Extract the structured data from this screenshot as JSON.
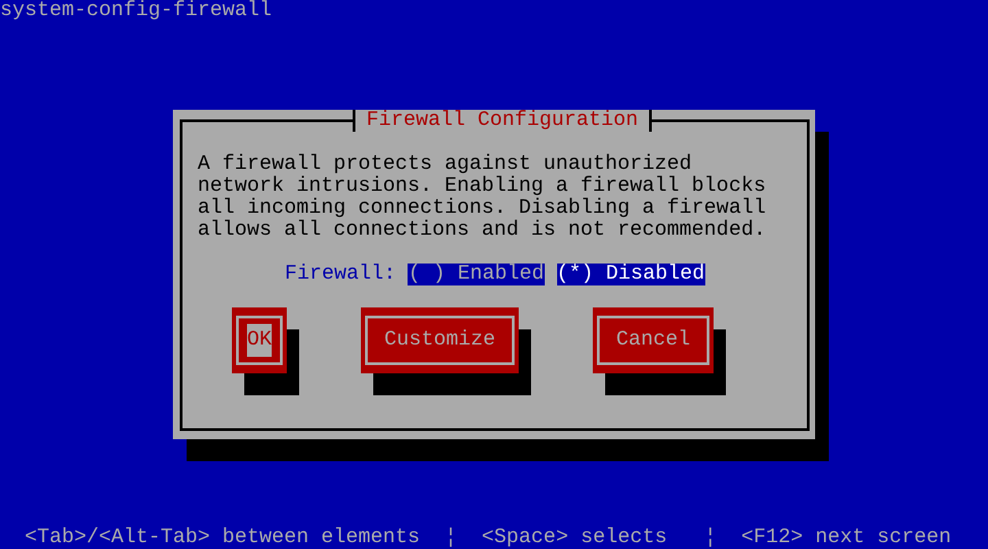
{
  "window": {
    "title": "system-config-firewall"
  },
  "dialog": {
    "title": "Firewall Configuration",
    "message": "A firewall protects against unauthorized\nnetwork intrusions. Enabling a firewall blocks\nall incoming connections. Disabling a firewall\nallows all connections and is not recommended.",
    "firewall_label": "Firewall:",
    "options": [
      {
        "marker": "( )",
        "label": "Enabled",
        "selected": false
      },
      {
        "marker": "(*)",
        "label": "Disabled",
        "selected": true
      }
    ],
    "buttons": [
      {
        "label": "OK",
        "focused": true
      },
      {
        "label": "Customize",
        "focused": false
      },
      {
        "label": "Cancel",
        "focused": false
      }
    ]
  },
  "status_bar": {
    "text": "<Tab>/<Alt-Tab> between elements  ¦  <Space> selects   ¦  <F12> next screen"
  }
}
